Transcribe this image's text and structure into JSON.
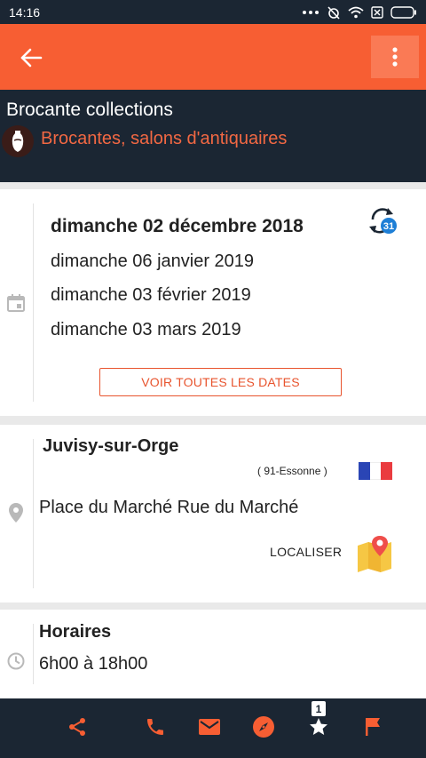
{
  "status_bar": {
    "time": "14:16"
  },
  "header": {
    "title": "Brocante collections",
    "category": "Brocantes, salons d'antiquaires"
  },
  "dates": {
    "items": [
      "dimanche 02 décembre 2018",
      "dimanche 06 janvier 2019",
      "dimanche 03 février 2019",
      "dimanche 03 mars 2019"
    ],
    "recurrence_badge": "31",
    "see_all_label": "VOIR TOUTES LES DATES"
  },
  "location": {
    "city": "Juvisy-sur-Orge",
    "department": "( 91-Essonne )",
    "address": "Place du Marché Rue du Marché",
    "locate_label": "LOCALISER"
  },
  "hours": {
    "title": "Horaires",
    "value": "6h00 à 18h00"
  },
  "bottom_bar": {
    "favorite_count": "1",
    "icons": [
      "share-icon",
      "phone-icon",
      "mail-icon",
      "compass-icon",
      "star-icon",
      "flag-icon"
    ]
  },
  "colors": {
    "accent": "#f75e33",
    "dark": "#1b2633"
  }
}
